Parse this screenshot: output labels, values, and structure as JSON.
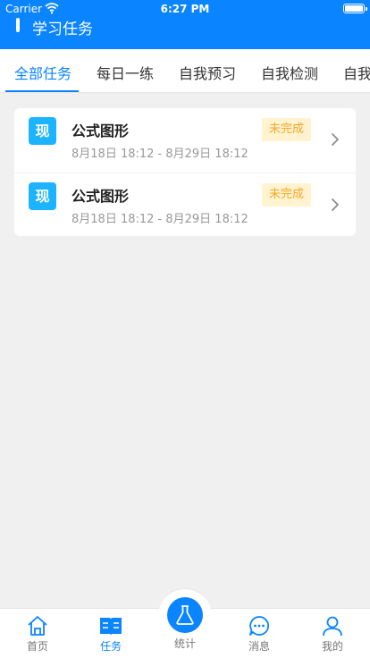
{
  "status_bar": {
    "carrier": "Carrier",
    "time": "6:27 PM"
  },
  "header": {
    "title": "学习任务"
  },
  "tabs": [
    {
      "label": "全部任务",
      "active": true
    },
    {
      "label": "每日一练",
      "active": false
    },
    {
      "label": "自我预习",
      "active": false
    },
    {
      "label": "自我检测",
      "active": false
    },
    {
      "label": "自我",
      "active": false
    }
  ],
  "tasks": [
    {
      "badge": "现",
      "name": "公式图形",
      "time": "8月18日 18:12 - 8月29日 18:12",
      "status": "未完成"
    },
    {
      "badge": "现",
      "name": "公式图形",
      "time": "8月18日 18:12 - 8月29日 18:12",
      "status": "未完成"
    }
  ],
  "tabbar": [
    {
      "label": "首页",
      "icon": "home-icon",
      "active": false
    },
    {
      "label": "任务",
      "icon": "book-icon",
      "active": true
    },
    {
      "label": "统计",
      "icon": "flask-icon",
      "active": false
    },
    {
      "label": "消息",
      "icon": "chat-icon",
      "active": false
    },
    {
      "label": "我的",
      "icon": "person-icon",
      "active": false
    }
  ],
  "colors": {
    "primary": "#0a84ff",
    "badge": "#1db4ff",
    "status_bg": "#fff3d0",
    "status_text": "#f5a623"
  }
}
